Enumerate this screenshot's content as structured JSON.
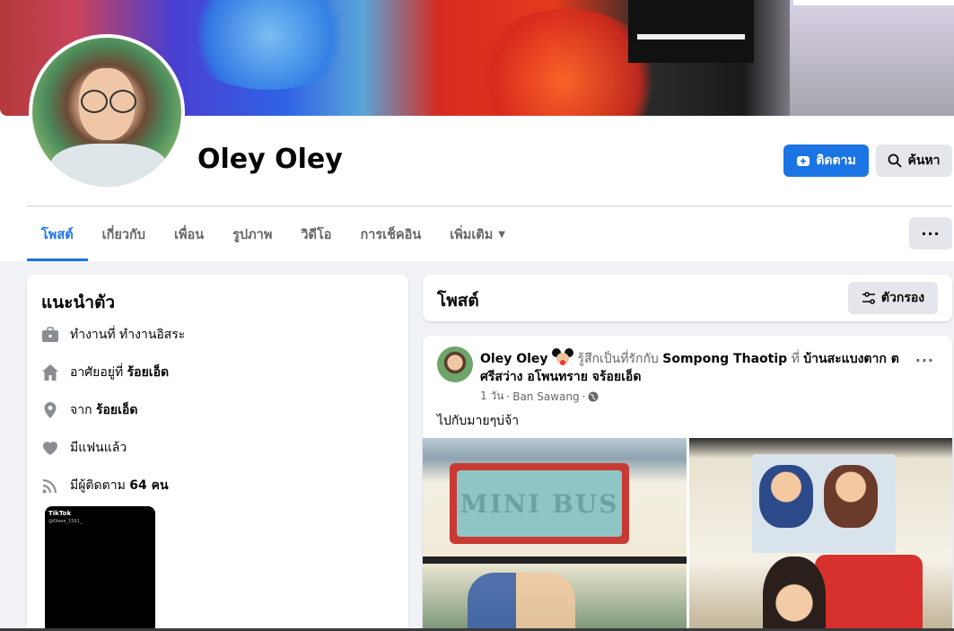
{
  "profile": {
    "name": "Oley Oley"
  },
  "actions": {
    "follow_label": "ติดตาม",
    "search_label": "ค้นหา",
    "more_label": "···"
  },
  "tabs": [
    {
      "label": "โพสต์",
      "active": true
    },
    {
      "label": "เกี่ยวกับ"
    },
    {
      "label": "เพื่อน"
    },
    {
      "label": "รูปภาพ"
    },
    {
      "label": "วิดีโอ"
    },
    {
      "label": "การเช็คอิน"
    },
    {
      "label": "เพิ่มเติม"
    }
  ],
  "intro": {
    "title": "แนะนำตัว",
    "work_prefix": "ทำงานที่ ทำงานอิสระ",
    "lives_prefix": "อาศัยอยู่ที่ ",
    "lives_place": "ร้อยเอ็ด",
    "from_prefix": "จาก ",
    "from_place": "ร้อยเอ็ด",
    "relationship": "มีแฟนแล้ว",
    "followers_prefix": "มีผู้ติดตาม ",
    "followers_count": "64 คน",
    "tiktok_logo": "TikTok",
    "tiktok_handle": "@Oleee_1591_"
  },
  "posts_header": {
    "title": "โพสต์",
    "filter_label": "ตัวกรอง"
  },
  "post": {
    "author": "Oley Oley",
    "feeling": "รู้สึกเป็นที่รักกับ",
    "with_person": "Sompong Thaotip",
    "at_word": "ที่",
    "location": "บ้านสะแบงตาก ตศรีสว่าง อโพนทราย จร้อยเอ็ด",
    "time": "1 วัน",
    "place": "Ban Sawang",
    "text": "ไปกับมายๆบ่จ้า",
    "photo1_sign": "MINI BUS"
  },
  "colors": {
    "accent": "#1b74e4",
    "background": "#f0f2f5",
    "secondary_button": "#e4e6eb"
  },
  "icons": {
    "follow": "user-plus-icon",
    "search": "search-icon",
    "work": "briefcase-icon",
    "home": "home-icon",
    "location": "pin-icon",
    "relationship": "heart-icon",
    "followers": "rss-icon",
    "filter": "sliders-icon",
    "privacy": "globe-icon"
  }
}
